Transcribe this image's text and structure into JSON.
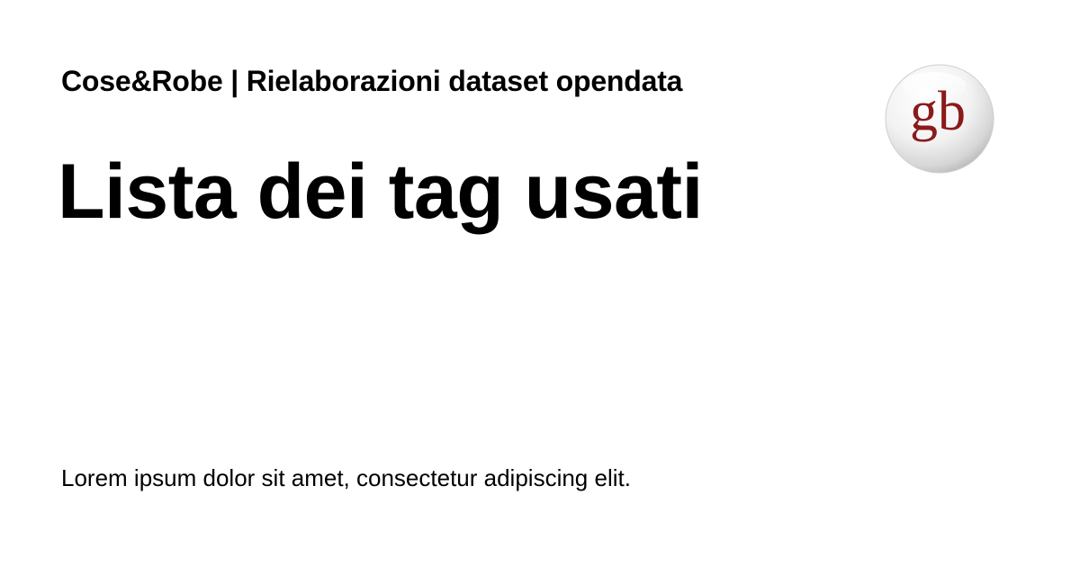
{
  "header": {
    "site_title": "Cose&Robe | Rielaborazioni dataset opendata"
  },
  "main": {
    "title": "Lista dei tag usati",
    "description": "Lorem ipsum dolor sit amet, consectetur adipiscing elit."
  },
  "logo": {
    "text": "gb",
    "icon": "gb-logo-icon",
    "letter_color": "#8b1a1a"
  }
}
